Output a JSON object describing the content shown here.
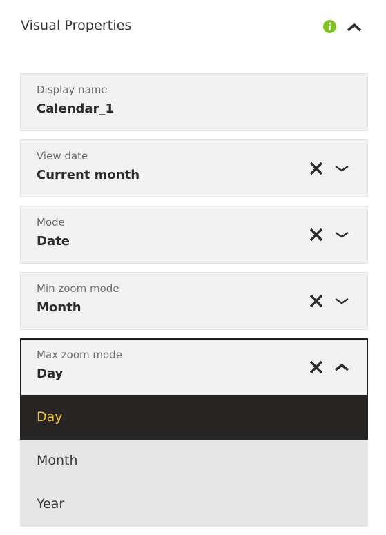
{
  "header": {
    "title": "Visual Properties",
    "info_icon": "info-icon",
    "collapse_icon": "chevron-up-icon",
    "info_color": "#7dc31e"
  },
  "fields": [
    {
      "label": "Display name",
      "value": "Calendar_1"
    },
    {
      "label": "View date",
      "value": "Current month",
      "clear_icon": "close-icon",
      "toggle_icon": "chevron-down-icon"
    },
    {
      "label": "Mode",
      "value": "Date",
      "clear_icon": "close-icon",
      "toggle_icon": "chevron-down-icon"
    },
    {
      "label": "Min zoom mode",
      "value": "Month",
      "clear_icon": "close-icon",
      "toggle_icon": "chevron-down-icon"
    },
    {
      "label": "Max zoom mode",
      "value": "Day",
      "clear_icon": "close-icon",
      "toggle_icon": "chevron-up-icon",
      "open": true
    }
  ],
  "dropdown": {
    "options": [
      "Day",
      "Month",
      "Year"
    ],
    "selected": "Day",
    "selected_bg": "#282624",
    "selected_color": "#f4c22f"
  }
}
